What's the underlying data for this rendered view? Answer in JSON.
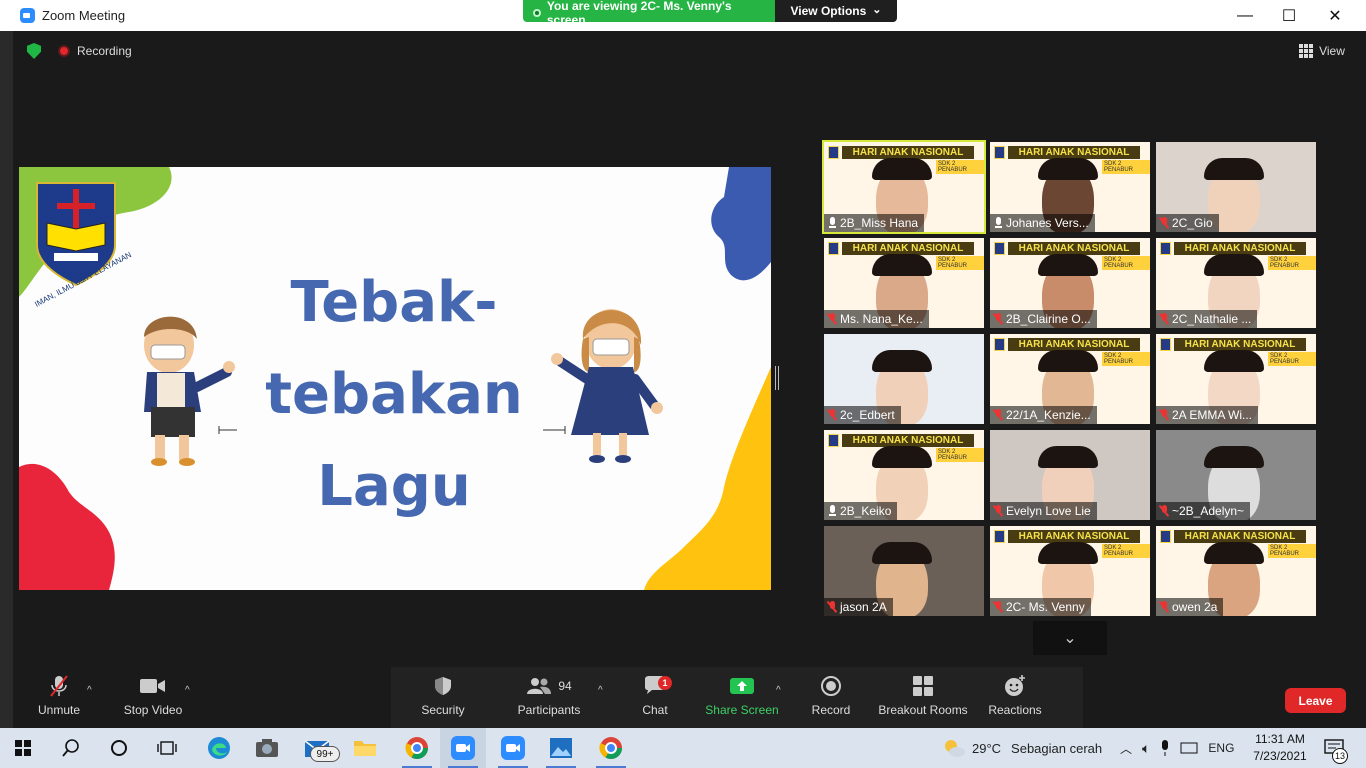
{
  "window": {
    "title": "Zoom Meeting",
    "minimize": "—",
    "maximize": "☐",
    "close": "✕"
  },
  "share_banner": {
    "viewing_text": "You are viewing 2C- Ms. Venny's screen",
    "view_options": "View Options",
    "chevron": "⌄"
  },
  "header": {
    "recording_label": "Recording",
    "view_label": "View"
  },
  "slide": {
    "title_line1": "Tebak-",
    "title_line2": "tebakan",
    "title_line3": "Lagu",
    "logo_banner": "BPK PENABUR",
    "logo_motto": "IMAN, ILMU dan PELAYANAN"
  },
  "participants_tiles": [
    {
      "name": "2B_Miss Hana",
      "muted": false,
      "banner": true,
      "active": true
    },
    {
      "name": "Johanes Vers...",
      "muted": false,
      "banner": true,
      "active": false
    },
    {
      "name": "2C_Gio",
      "muted": true,
      "banner": false,
      "active": false
    },
    {
      "name": "Ms. Nana_Ke...",
      "muted": true,
      "banner": true,
      "active": false
    },
    {
      "name": "2B_Clairine O...",
      "muted": true,
      "banner": true,
      "active": false
    },
    {
      "name": "2C_Nathalie ...",
      "muted": true,
      "banner": true,
      "active": false
    },
    {
      "name": "2c_Edbert",
      "muted": true,
      "banner": false,
      "active": false
    },
    {
      "name": "22/1A_Kenzie...",
      "muted": true,
      "banner": true,
      "active": false
    },
    {
      "name": "2A EMMA Wi...",
      "muted": true,
      "banner": true,
      "active": false
    },
    {
      "name": "2B_Keiko",
      "muted": false,
      "banner": true,
      "active": false
    },
    {
      "name": "Evelyn Love Lie",
      "muted": true,
      "banner": false,
      "active": false
    },
    {
      "name": "~2B_Adelyn~",
      "muted": true,
      "banner": false,
      "active": false
    },
    {
      "name": "jason 2A",
      "muted": true,
      "banner": false,
      "active": false
    },
    {
      "name": "2C- Ms. Venny",
      "muted": true,
      "banner": true,
      "active": false
    },
    {
      "name": "owen 2a",
      "muted": true,
      "banner": true,
      "active": false
    }
  ],
  "banner_text": "HARI ANAK NASIONAL",
  "banner_sub": "SDK 2 PENABUR",
  "toolbar": {
    "unmute": "Unmute",
    "stop_video": "Stop Video",
    "security": "Security",
    "participants": "Participants",
    "participants_count": "94",
    "chat": "Chat",
    "chat_badge": "1",
    "share_screen": "Share Screen",
    "record": "Record",
    "breakout_rooms": "Breakout Rooms",
    "reactions": "Reactions",
    "leave": "Leave"
  },
  "taskbar": {
    "mail_badge": "99+",
    "weather_temp": "29°C",
    "weather_desc": "Sebagian cerah",
    "language": "ENG",
    "time": "11:31 AM",
    "date": "7/23/2021",
    "notifications": "13"
  },
  "colors": {
    "share_green": "#26b544",
    "leave_red": "#e02828",
    "slide_title_blue": "#4568b0",
    "active_speaker_border": "#d6e83a"
  }
}
